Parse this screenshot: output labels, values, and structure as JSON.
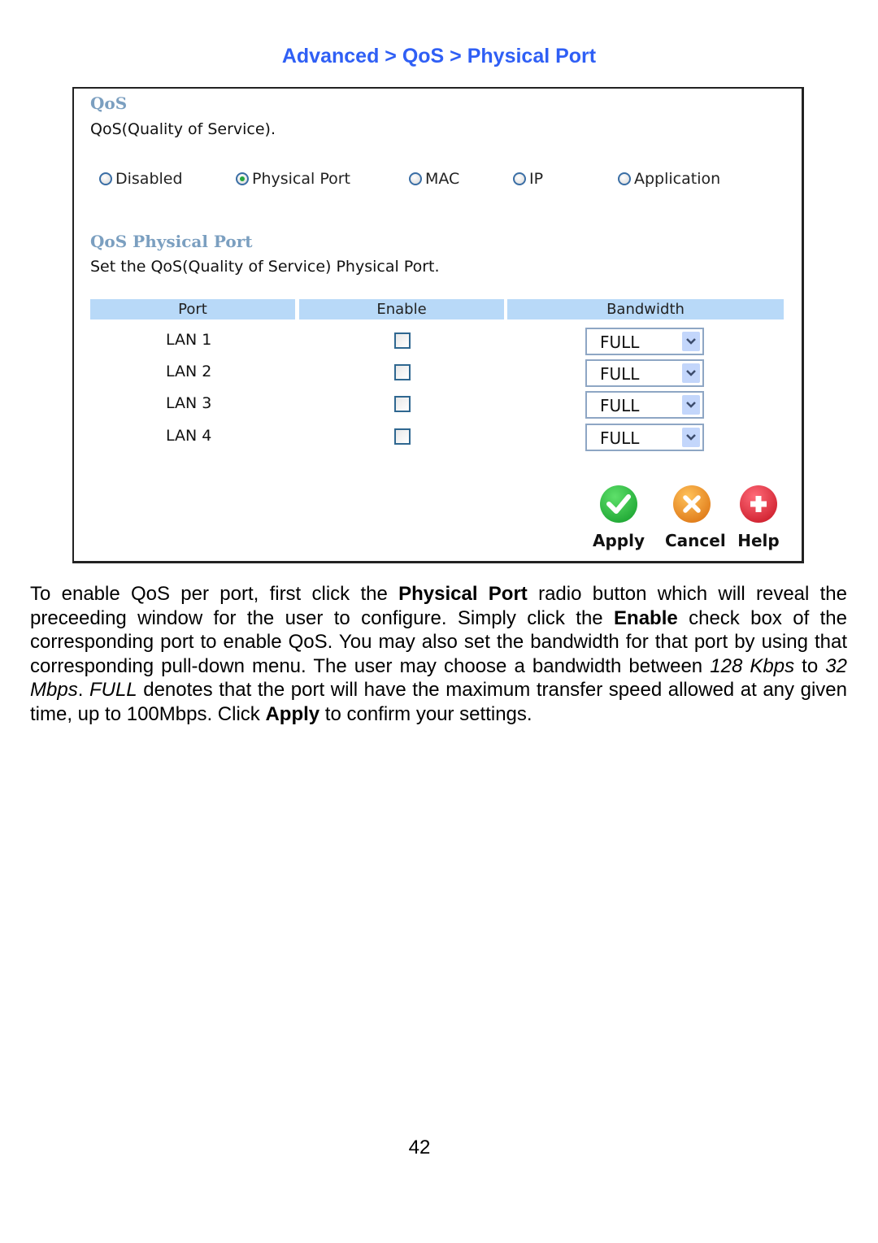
{
  "breadcrumb": "Advanced > QoS > Physical Port",
  "qos": {
    "title": "QoS",
    "description": "QoS(Quality of Service).",
    "modes": [
      {
        "label": "Disabled",
        "selected": false
      },
      {
        "label": "Physical Port",
        "selected": true
      },
      {
        "label": "MAC",
        "selected": false
      },
      {
        "label": "IP",
        "selected": false
      },
      {
        "label": "Application",
        "selected": false
      }
    ]
  },
  "physical_port": {
    "title": "QoS Physical Port",
    "description": "Set the QoS(Quality of Service) Physical Port.",
    "columns": [
      "Port",
      "Enable",
      "Bandwidth"
    ],
    "rows": [
      {
        "port": "LAN 1",
        "enabled": false,
        "bandwidth": "FULL"
      },
      {
        "port": "LAN 2",
        "enabled": false,
        "bandwidth": "FULL"
      },
      {
        "port": "LAN 3",
        "enabled": false,
        "bandwidth": "FULL"
      },
      {
        "port": "LAN 4",
        "enabled": false,
        "bandwidth": "FULL"
      }
    ]
  },
  "buttons": {
    "apply": "Apply",
    "cancel": "Cancel",
    "help": "Help"
  },
  "body": {
    "p1": "To enable QoS per port, first click the ",
    "b1": "Physical Port",
    "p2": " radio button which will reveal the preceeding window for the user to configure. Simply click the ",
    "b2": "Enable",
    "p3": " check box of the corresponding port to enable QoS. You may also set the bandwidth for that port by using that corresponding pull-down menu. The user may choose a bandwidth between ",
    "i1": "128 Kbps",
    "p4": " to ",
    "i2": "32 Mbps",
    "p5": ". ",
    "i3": "FULL",
    "p6": " denotes that the port will have the maximum transfer speed allowed at any given time, up to 100Mbps. Click ",
    "b3": "Apply",
    "p7": " to confirm your settings."
  },
  "page_number": "42",
  "colors": {
    "breadcrumb": "#2f5ff5",
    "section_title": "#7b9fc0",
    "table_header": "#b8d9f8"
  }
}
